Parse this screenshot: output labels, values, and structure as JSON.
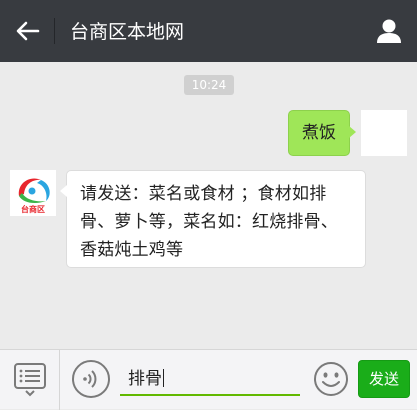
{
  "header": {
    "title": "台商区本地网",
    "back_icon": "arrow-left-icon",
    "user_icon": "user-profile-icon",
    "background": "#383b40"
  },
  "chat": {
    "timestamp": "10:24",
    "messages": [
      {
        "side": "right",
        "text": "煮饭",
        "bubble_color": "#9fe658"
      },
      {
        "side": "left",
        "sender_logo_text": "台商区",
        "text": "请发送：菜名或食材 ；食材如排骨、萝卜等，菜名如：红烧排骨、香菇炖土鸡等",
        "bubble_color": "#ffffff"
      }
    ]
  },
  "input_bar": {
    "menu_icon": "menu-list-icon",
    "voice_icon": "voice-icon",
    "input_value": "排骨",
    "emoji_icon": "emoji-smile-icon",
    "send_label": "发送",
    "accent": "#62b900",
    "send_color": "#1aad19"
  }
}
